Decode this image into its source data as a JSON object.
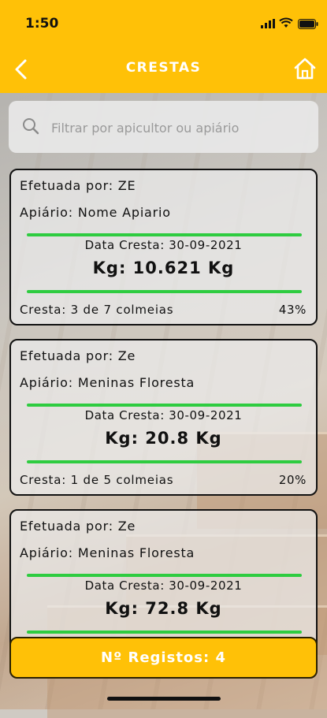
{
  "status_bar": {
    "time": "1:50"
  },
  "header": {
    "title": "CRESTAS"
  },
  "search": {
    "placeholder": "Filtrar por apicultor ou apiário",
    "value": ""
  },
  "records": [
    {
      "efetuada": "Efetuada por: ZE",
      "apiario": "Apiário: Nome Apiario",
      "data": "Data Cresta: 30-09-2021",
      "kg": "Kg: 10.621 Kg",
      "cresta": "Cresta: 3 de 7 colmeias",
      "percent": "43%"
    },
    {
      "efetuada": "Efetuada por: Ze",
      "apiario": "Apiário: Meninas Floresta",
      "data": "Data Cresta: 30-09-2021",
      "kg": "Kg: 20.8 Kg",
      "cresta": "Cresta: 1 de 5 colmeias",
      "percent": "20%"
    },
    {
      "efetuada": "Efetuada por: Ze",
      "apiario": "Apiário: Meninas Floresta",
      "data": "Data Cresta: 30-09-2021",
      "kg": "Kg: 72.8 Kg",
      "cresta": "",
      "percent": ""
    }
  ],
  "footer": {
    "count_label": "Nº Registos: 4"
  },
  "colors": {
    "accent": "#FFC107",
    "divider": "#2ecc40"
  }
}
